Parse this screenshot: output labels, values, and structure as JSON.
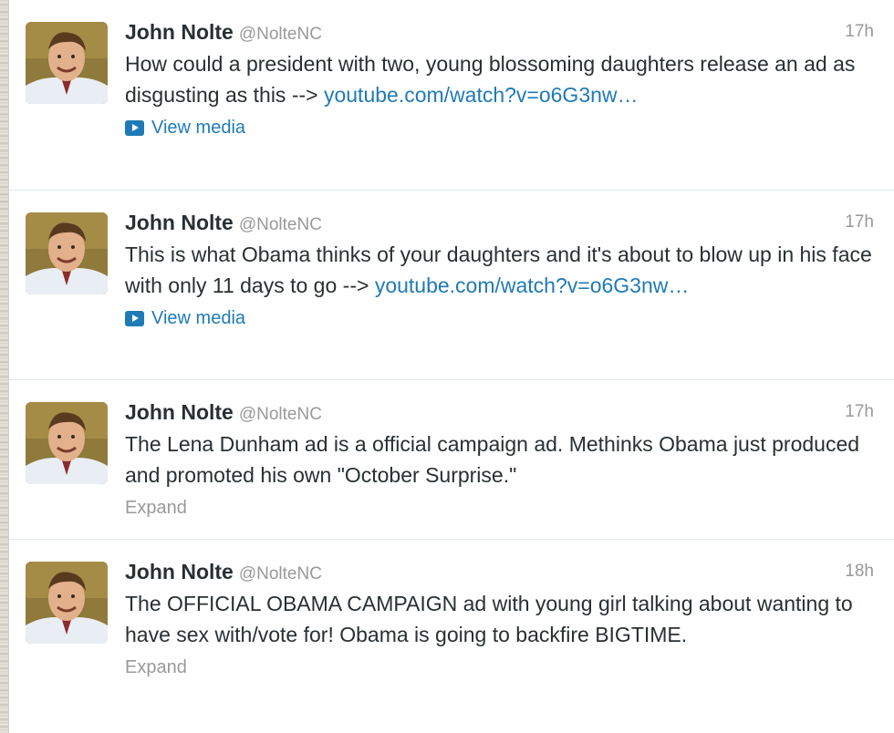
{
  "tweets": [
    {
      "name": "John Nolte",
      "handle": "@NolteNC",
      "time": "17h",
      "text": "How could a president with two, young blossoming daughters release an ad as disgusting as this --> ",
      "link": "youtube.com/watch?v=o6G3nw…",
      "action": "View media",
      "action_icon": "media-play-icon"
    },
    {
      "name": "John Nolte",
      "handle": "@NolteNC",
      "time": "17h",
      "text": "This is what Obama thinks of your daughters and it's about to blow up in his face with only 11 days to go --> ",
      "link": "youtube.com/watch?v=o6G3nw…",
      "action": "View media",
      "action_icon": "media-play-icon"
    },
    {
      "name": "John Nolte",
      "handle": "@NolteNC",
      "time": "17h",
      "text": "The Lena Dunham ad is a official campaign ad. Methinks Obama just produced and promoted his own \"October Surprise.\"",
      "link": "",
      "action": "Expand"
    },
    {
      "name": "John Nolte",
      "handle": "@NolteNC",
      "time": "18h",
      "text": "The OFFICIAL OBAMA CAMPAIGN ad with young girl talking about wanting to have sex with/vote for! Obama is going to backfire BIGTIME.",
      "link": "",
      "action": "Expand"
    }
  ],
  "colors": {
    "link": "#1f7ab8",
    "name": "#292f33",
    "muted": "#999999"
  }
}
